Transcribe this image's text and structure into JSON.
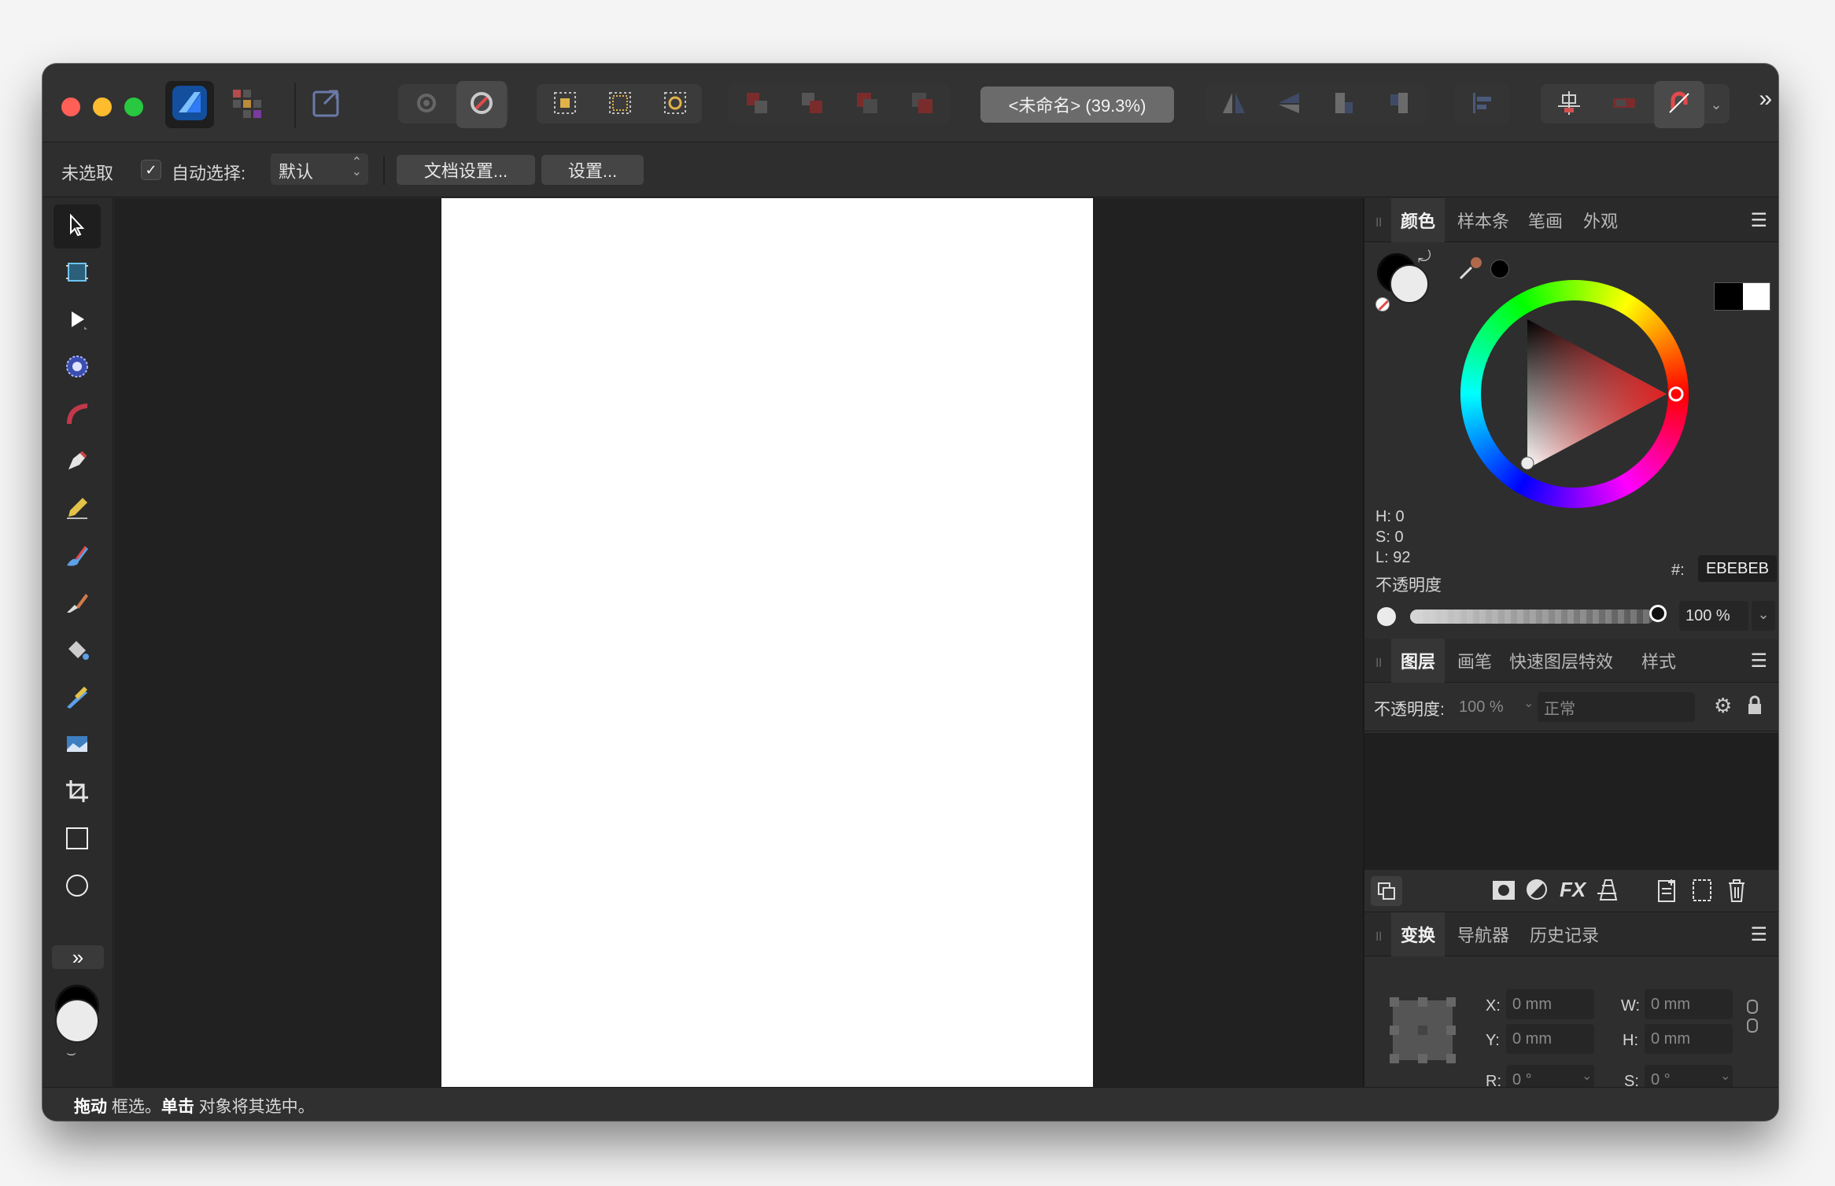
{
  "window": {
    "title": "<未命名> (39.3%)"
  },
  "context_bar": {
    "selection_status": "未选取",
    "auto_select_label": "自动选择:",
    "auto_select_checked": true,
    "auto_select_value": "默认",
    "document_setup_button": "文档设置...",
    "settings_button": "设置..."
  },
  "color_panel": {
    "tabs": [
      "颜色",
      "样本条",
      "笔画",
      "外观"
    ],
    "active_tab": "颜色",
    "h": "H: 0",
    "s": "S: 0",
    "l": "L: 92",
    "hex_label": "#:",
    "hex_value": "EBEBEB",
    "opacity_label": "不透明度",
    "opacity_value": "100 %",
    "fill_color": "#ebebeb"
  },
  "layers_panel": {
    "tabs": [
      "图层",
      "画笔",
      "快速图层特效",
      "样式"
    ],
    "active_tab": "图层",
    "opacity_label": "不透明度:",
    "opacity_value": "100 %",
    "blend_mode": "正常"
  },
  "transform_panel": {
    "tabs": [
      "变换",
      "导航器",
      "历史记录"
    ],
    "active_tab": "变换",
    "x_label": "X:",
    "x_value": "0 mm",
    "y_label": "Y:",
    "y_value": "0 mm",
    "w_label": "W:",
    "w_value": "0 mm",
    "h_label": "H:",
    "h_value": "0 mm",
    "r_label": "R:",
    "r_value": "0 °",
    "s_label": "S:",
    "s_value": "0 °"
  },
  "status_bar": {
    "drag_word": "拖动",
    "drag_text": " 框选。",
    "click_word": "单击",
    "click_text": " 对象将其选中。"
  },
  "colors": {
    "app_accent": "#2f7bf5",
    "window_bg": "#2b2b2b",
    "canvas_bg": "#212121",
    "page_bg": "#ffffff"
  },
  "icons": {
    "toolbar": [
      "app-logo-icon",
      "personas-icon",
      "export-persona-icon",
      "snapping-icon",
      "snapping-options-icon",
      "select-inside-icon",
      "select-all-icon",
      "select-object-icon",
      "move-back-icon",
      "move-forward-icon",
      "send-back-icon",
      "bring-front-icon",
      "flip-horizontal-icon",
      "flip-vertical-icon",
      "rotate-left-icon",
      "rotate-right-icon",
      "align-icon",
      "distribute-icon",
      "toggle-icon",
      "magnet-icon"
    ],
    "tools": [
      "move-tool-icon",
      "artboard-tool-icon",
      "node-tool-icon",
      "point-transform-tool-icon",
      "corner-tool-icon",
      "pen-tool-icon",
      "pencil-tool-icon",
      "vector-brush-tool-icon",
      "paint-brush-tool-icon",
      "fill-tool-icon",
      "transparency-tool-icon",
      "place-image-tool-icon",
      "crop-tool-icon",
      "rectangle-tool-icon",
      "ellipse-tool-icon"
    ]
  }
}
